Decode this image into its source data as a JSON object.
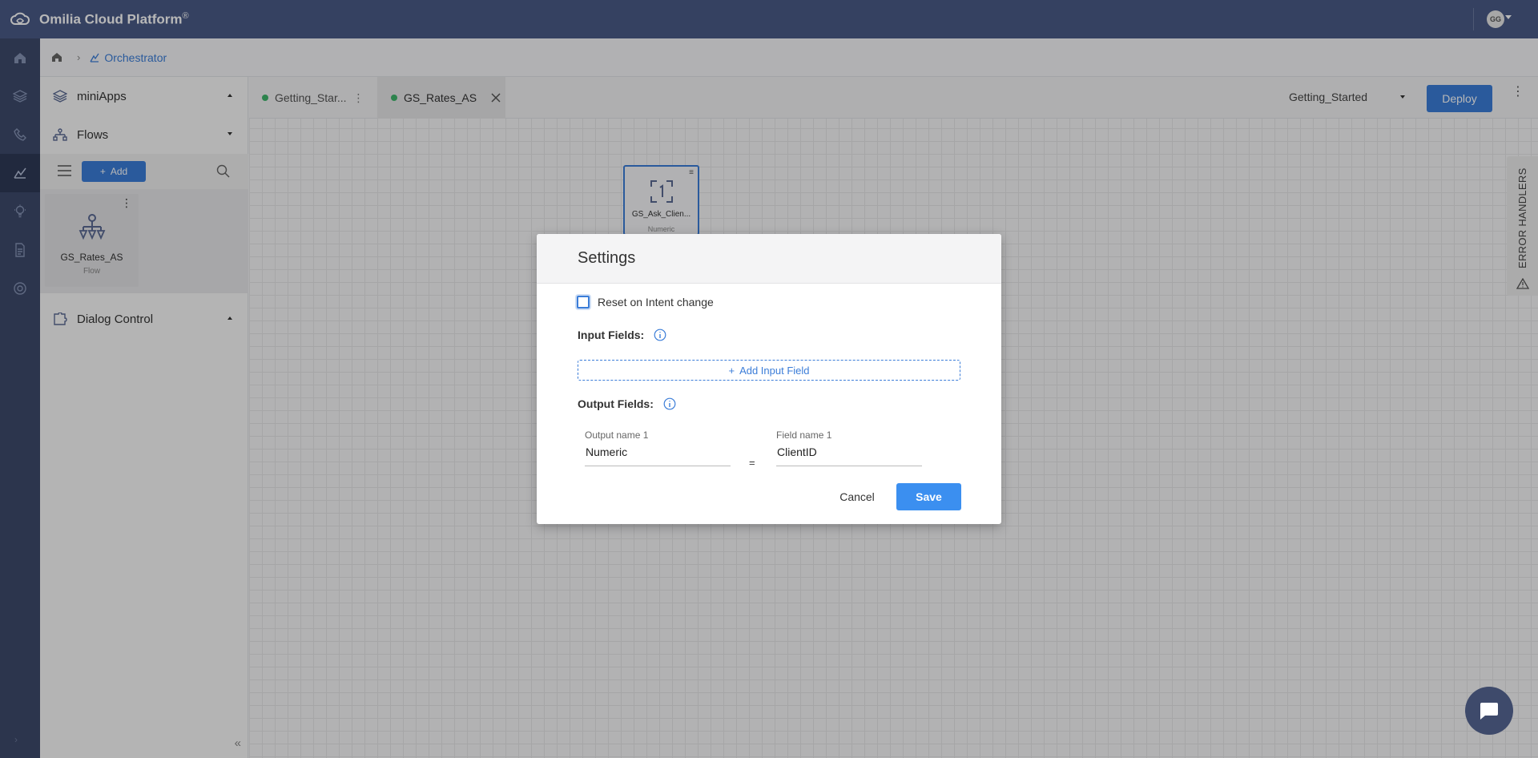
{
  "app": {
    "title": "Omilia Cloud Platform",
    "title_mark": "®",
    "user_initials": "GG"
  },
  "breadcrumb": {
    "current": "Orchestrator"
  },
  "sidebar": {
    "sections": {
      "miniapps": "miniApps",
      "flows": "Flows",
      "dialog_control": "Dialog Control"
    },
    "add_label": "Add",
    "flow_cards": [
      {
        "name": "GS_Rates_AS",
        "type": "Flow"
      }
    ]
  },
  "tabs": [
    {
      "label": "Getting_Star...",
      "active": false
    },
    {
      "label": "GS_Rates_AS",
      "active": true
    }
  ],
  "toolbar": {
    "flow_selected": "Getting_Started",
    "deploy_label": "Deploy"
  },
  "canvas": {
    "node": {
      "name": "GS_Ask_Clien...",
      "type": "Numeric"
    },
    "error_handlers_label": "ERROR HANDLERS"
  },
  "modal": {
    "title": "Settings",
    "reset_checkbox_label": "Reset on Intent change",
    "reset_checked": false,
    "input_fields_label": "Input Fields:",
    "add_input_label": "Add Input Field",
    "output_fields_label": "Output Fields:",
    "output_name_label": "Output name 1",
    "output_name_value": "Numeric",
    "equals": "=",
    "field_name_label": "Field name 1",
    "field_name_value": "ClientID",
    "cancel_label": "Cancel",
    "save_label": "Save"
  },
  "colors": {
    "topbar": "#4a5a87",
    "rail": "#3e4a6b",
    "accent": "#3b7dd8",
    "status_dot": "#3fb66b"
  }
}
